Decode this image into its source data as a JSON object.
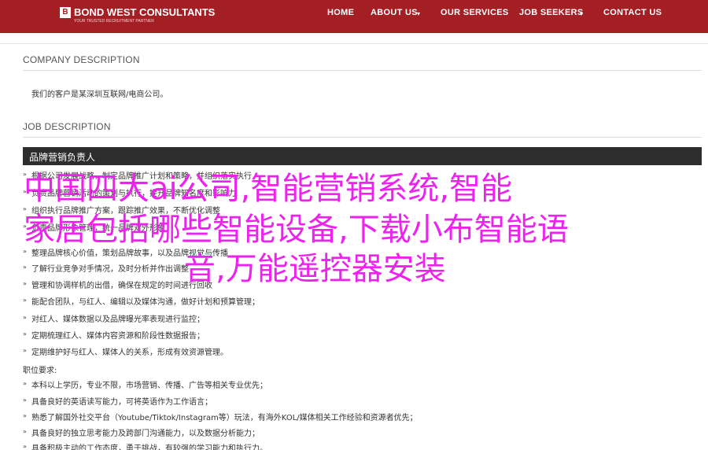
{
  "brand": {
    "name": "BOND WEST CONSULTANTS",
    "tagline": "YOUR TRUSTED RECRUITMENT PARTNER",
    "mark": "B"
  },
  "nav": {
    "items": [
      {
        "label": "HOME"
      },
      {
        "label": "ABOUT US",
        "caret": "▾"
      },
      {
        "label": "OUR SERVICES"
      },
      {
        "label": "JOB SEEKERS",
        "caret": "▾"
      },
      {
        "label": "CONTACT US"
      }
    ]
  },
  "company": {
    "heading": "COMPANY DESCRIPTION",
    "text": "我们的客户是某深圳互联网/电商公司。"
  },
  "job": {
    "heading": "JOB DESCRIPTION",
    "title": "品牌营销负责人",
    "duties": [
      "根据公司发展战略，制定品牌推广计划和策略，并组织落实执行",
      "负责品牌营销活动的策划与执行，提升品牌知名度和影响力",
      "组织执行品牌推广方案，跟踪推广效果，不断优化调整",
      "负责品牌形象管理，统一品牌对外形象",
      "整理品牌核心价值，策划品牌故事，以及品牌视觉与传播",
      "了解行业竞争对手情况，及时分析并作出调整",
      "管理和协调样机的出借，确保在规定的时间进行回收",
      "能配合团队，与红人、编辑以及媒体沟通，做好计划和预算管理；",
      "对红人、媒体数据以及品牌曝光率表现进行监控；",
      "定期梳理红人、媒体内容资源和阶段性数据报告；",
      "定期维护好与红人、媒体人的关系，形成有效资源管理。"
    ]
  },
  "requirements": {
    "heading": "职位要求:",
    "items": [
      "本科以上学历，专业不限，市场营销、传播、广告等相关专业优先；",
      "具备良好的英语读写能力，可将英语作为工作语言；",
      "熟悉了解国外社交平台（Youtube/Tiktok/Instagram等）玩法，有海外KOL/媒体相关工作经验和资源者优先；",
      "具备良好的独立思考能力及跨部门沟通能力，以及数据分析能力；",
      "具备积极主动的工作态度，勇于挑战，有较强的学习能力和执行力。"
    ]
  },
  "overlay": {
    "lines": [
      "中国四大ai公司,智能营销系统,智能",
      "家居包括哪些智能设备,下载小布智能语",
      "音,万能遥控器安装"
    ],
    "color": "#ee22ee"
  },
  "colors": {
    "brand_red": "#a31f24",
    "job_bar": "#2d2d2d"
  }
}
